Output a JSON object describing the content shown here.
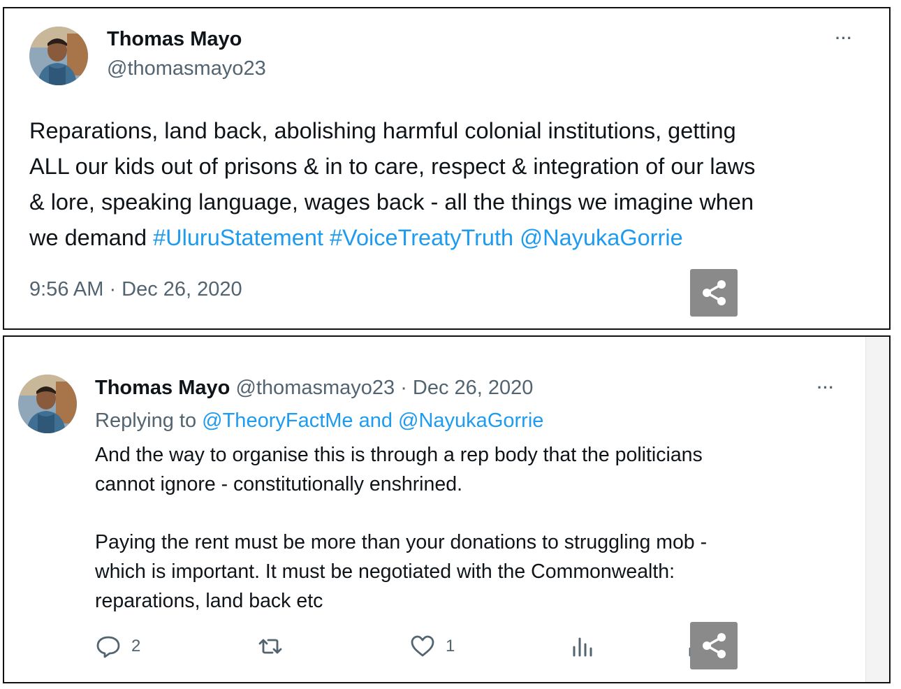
{
  "tweet": {
    "author_name": "Thomas Mayo",
    "author_handle": "@thomasmayo23",
    "text_lines": [
      "Reparations, land back, abolishing harmful colonial institutions, getting",
      "ALL our kids out of prisons & in to care, respect & integration of our laws",
      "& lore, speaking language, wages back - all the things we imagine when"
    ],
    "last_line_prefix": "we demand ",
    "hashtag_1": "#UluruStatement",
    "hashtag_2": "#VoiceTreatyTruth",
    "mention": "@NayukaGorrie",
    "timestamp": "9:56 AM · Dec 26, 2020",
    "more_label": "···"
  },
  "reply": {
    "author_name": "Thomas Mayo",
    "author_handle_date": "@thomasmayo23 · Dec 26, 2020",
    "replying_prefix": "Replying to ",
    "replying_user_1": "@TheoryFactMe",
    "replying_and": " and ",
    "replying_user_2": "@NayukaGorrie",
    "paragraph_1_lines": [
      "And the way to organise this is through a rep body that the politicians",
      "cannot ignore - constitutionally enshrined."
    ],
    "paragraph_2_lines": [
      "Paying the rent must be more than your donations to struggling mob -",
      "which is important. It must be negotiated with the Commonwealth:",
      "reparations, land back etc"
    ],
    "more_label": "···",
    "actions": {
      "reply_count": "2",
      "like_count": "1"
    }
  },
  "icons": [
    "avatar",
    "more-icon",
    "share-icon",
    "reply-icon",
    "retweet-icon",
    "like-icon",
    "views-icon",
    "upload-icon"
  ],
  "colors": {
    "link": "#1d9bf0",
    "muted": "#536471",
    "share_bg": "#8a8a8a"
  }
}
